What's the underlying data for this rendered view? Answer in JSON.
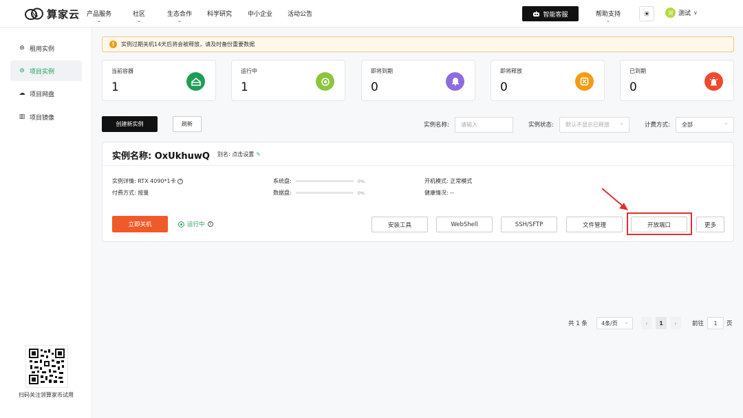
{
  "topbar": {
    "brand": "算家云",
    "logo_mark": "%",
    "nav": [
      {
        "label": "产品服务",
        "dropdown": true
      },
      {
        "label": "社区",
        "dropdown": true
      },
      {
        "label": "生态合作",
        "dropdown": true
      },
      {
        "label": "科学研究",
        "dropdown": false
      },
      {
        "label": "中小企业",
        "dropdown": false
      },
      {
        "label": "活动公告",
        "dropdown": false
      }
    ],
    "smart_service": "智能客服",
    "help": "帮助支持",
    "theme_icon": "sun-icon",
    "user_initial": "测",
    "user_name": "测试"
  },
  "sidebar": {
    "items": [
      {
        "label": "租用实例",
        "icon": "rent-icon",
        "active": false
      },
      {
        "label": "项目实例",
        "icon": "instance-icon",
        "active": true
      },
      {
        "label": "项目网盘",
        "icon": "cloud-disk-icon",
        "active": false
      },
      {
        "label": "项目镜像",
        "icon": "image-icon",
        "active": false
      }
    ],
    "qr_caption": "扫码关注领算家币试用"
  },
  "alert": {
    "text": "实例过期关机14天后将会被释放，请及时备份重要数据"
  },
  "stats": [
    {
      "label": "当前容器",
      "value": "1",
      "color": "#1f9d55",
      "icon": "container-icon"
    },
    {
      "label": "运行中",
      "value": "1",
      "color": "#8cc63f",
      "icon": "running-icon"
    },
    {
      "label": "即将到期",
      "value": "0",
      "color": "#8e6ce0",
      "icon": "bell-icon"
    },
    {
      "label": "即将释放",
      "value": "0",
      "color": "#f39c12",
      "icon": "release-icon"
    },
    {
      "label": "已到期",
      "value": "0",
      "color": "#ef4a2f",
      "icon": "alarm-icon"
    }
  ],
  "toolbar": {
    "create": "创建新实例",
    "refresh": "刷新",
    "name_label": "实例名称:",
    "name_placeholder": "请输入",
    "state_label": "实例状态:",
    "state_placeholder": "默认不显示已释放",
    "billing_label": "计费方式:",
    "billing_value": "全部"
  },
  "instance": {
    "title": "实例名称: OxUkhuwQ",
    "alias": "别名: 点击设置",
    "detail_label": "实例详情:",
    "detail_value": "RTX 4090*1卡",
    "billing_label": "付费方式:",
    "billing_value": "按量",
    "sys_disk_label": "系统盘:",
    "sys_disk_pct": "0%",
    "data_disk_label": "数据盘:",
    "data_disk_pct": "0%",
    "boot_label": "开机模式:",
    "boot_value": "正常模式",
    "health_label": "健康情况:",
    "health_value": "--",
    "shutdown": "立即关机",
    "status": "运行中",
    "actions": [
      "安装工具",
      "WebShell",
      "SSH/SFTP",
      "文件管理",
      "开放端口",
      "更多"
    ]
  },
  "pagination": {
    "total": "共 1 条",
    "page_size": "4条/页",
    "current_page": "1",
    "goto_label": "前往",
    "goto_value": "1",
    "page_suffix": "页"
  }
}
